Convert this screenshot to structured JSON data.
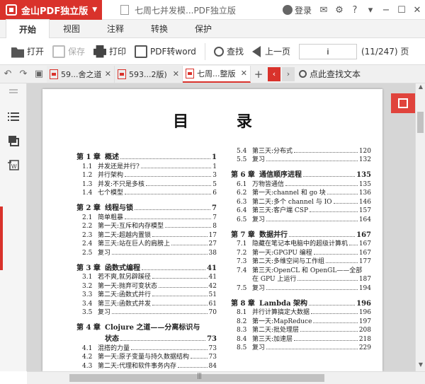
{
  "app": {
    "name": "金山PDF独立版",
    "doc_title": "七周七并发模...PDF独立版",
    "login": "登录"
  },
  "menu": {
    "tabs": [
      "开始",
      "视图",
      "注释",
      "转换",
      "保护"
    ],
    "active": 0
  },
  "toolbar": {
    "open": "打开",
    "save": "保存",
    "print": "打印",
    "pdf_to_word": "PDF转word",
    "find": "查找",
    "prev_page": "上一页",
    "page_value": "i",
    "page_count": "(11/247) 页"
  },
  "tabs": {
    "docs": [
      {
        "label": "59...舍之道"
      },
      {
        "label": "593...2版)"
      },
      {
        "label": "七周...整版"
      }
    ],
    "active": 2,
    "find_text": "点此查找文本"
  },
  "page": {
    "title": "目 录",
    "left": [
      {
        "type": "chap",
        "num": "第 1 章",
        "text": "概述",
        "page": "1"
      },
      {
        "type": "item",
        "num": "1.1",
        "text": "并发还是并行?",
        "page": "1"
      },
      {
        "type": "item",
        "num": "1.2",
        "text": "并行架构",
        "page": "3"
      },
      {
        "type": "item",
        "num": "1.3",
        "text": "并发:不只是多核",
        "page": "5"
      },
      {
        "type": "item",
        "num": "1.4",
        "text": "七个模型",
        "page": "6"
      },
      {
        "type": "chap",
        "num": "第 2 章",
        "text": "线程与锁",
        "page": "7"
      },
      {
        "type": "item",
        "num": "2.1",
        "text": "简单粗暴",
        "page": "7"
      },
      {
        "type": "item",
        "num": "2.2",
        "text": "第一天:互斥和内存模型",
        "page": "8"
      },
      {
        "type": "item",
        "num": "2.3",
        "text": "第二天:超越内置锁",
        "page": "17"
      },
      {
        "type": "item",
        "num": "2.4",
        "text": "第三天:站在巨人的肩膀上",
        "page": "27"
      },
      {
        "type": "item",
        "num": "2.5",
        "text": "复习",
        "page": "38"
      },
      {
        "type": "chap",
        "num": "第 3 章",
        "text": "函数式编程",
        "page": "41"
      },
      {
        "type": "item",
        "num": "3.1",
        "text": "若不爽,就另辟蹊径",
        "page": "41"
      },
      {
        "type": "item",
        "num": "3.2",
        "text": "第一天:抛弃可变状态",
        "page": "42"
      },
      {
        "type": "item",
        "num": "3.3",
        "text": "第二天:函数式并行",
        "page": "51"
      },
      {
        "type": "item",
        "num": "3.4",
        "text": "第三天:函数式并发",
        "page": "61"
      },
      {
        "type": "item",
        "num": "3.5",
        "text": "复习",
        "page": "70"
      },
      {
        "type": "chap",
        "num": "第 4 章",
        "text": "Clojure 之道——分离标识与",
        "page": ""
      },
      {
        "type": "chap2",
        "num": "",
        "text": "状态",
        "page": "73"
      },
      {
        "type": "item",
        "num": "4.1",
        "text": "混搭的力量",
        "page": "73"
      },
      {
        "type": "item",
        "num": "4.2",
        "text": "第一天:原子变量与持久数据结构",
        "page": "73"
      },
      {
        "type": "item",
        "num": "4.3",
        "text": "第二天:代理和软件事务内存",
        "page": "84"
      }
    ],
    "right": [
      {
        "type": "item",
        "num": "5.4",
        "text": "第三天:分布式",
        "page": "120"
      },
      {
        "type": "item",
        "num": "5.5",
        "text": "复习",
        "page": "132"
      },
      {
        "type": "chap",
        "num": "第 6 章",
        "text": "通信顺序进程",
        "page": "135"
      },
      {
        "type": "item",
        "num": "6.1",
        "text": "万物皆通信",
        "page": "135"
      },
      {
        "type": "item",
        "num": "6.2",
        "text": "第一天:channel 和 go 块",
        "page": "136"
      },
      {
        "type": "item",
        "num": "6.3",
        "text": "第二天:多个 channel 与 IO",
        "page": "146"
      },
      {
        "type": "item",
        "num": "6.4",
        "text": "第三天:客户端 CSP",
        "page": "157"
      },
      {
        "type": "item",
        "num": "6.5",
        "text": "复习",
        "page": "164"
      },
      {
        "type": "chap",
        "num": "第 7 章",
        "text": "数据并行",
        "page": "167"
      },
      {
        "type": "item",
        "num": "7.1",
        "text": "隐藏在笔记本电脑中的超级计算机",
        "page": "167"
      },
      {
        "type": "item",
        "num": "7.2",
        "text": "第一天:GPGPU 编程",
        "page": "167"
      },
      {
        "type": "item",
        "num": "7.3",
        "text": "第二天:多维空间与工作组",
        "page": "177"
      },
      {
        "type": "item",
        "num": "7.4",
        "text": "第三天:OpenCL 和 OpenGL——全部",
        "page": ""
      },
      {
        "type": "item2",
        "num": "",
        "text": "在 GPU 上运行",
        "page": "187"
      },
      {
        "type": "item",
        "num": "7.5",
        "text": "复习",
        "page": "194"
      },
      {
        "type": "chap",
        "num": "第 8 章",
        "text": "Lambda 架构",
        "page": "196"
      },
      {
        "type": "item",
        "num": "8.1",
        "text": "并行计算搞定大数据",
        "page": "196"
      },
      {
        "type": "item",
        "num": "8.2",
        "text": "第一天:MapReduce",
        "page": "197"
      },
      {
        "type": "item",
        "num": "8.3",
        "text": "第二天:批处理层",
        "page": "208"
      },
      {
        "type": "item",
        "num": "8.4",
        "text": "第三天:加速层",
        "page": "218"
      },
      {
        "type": "item",
        "num": "8.5",
        "text": "复习",
        "page": "229"
      }
    ]
  }
}
